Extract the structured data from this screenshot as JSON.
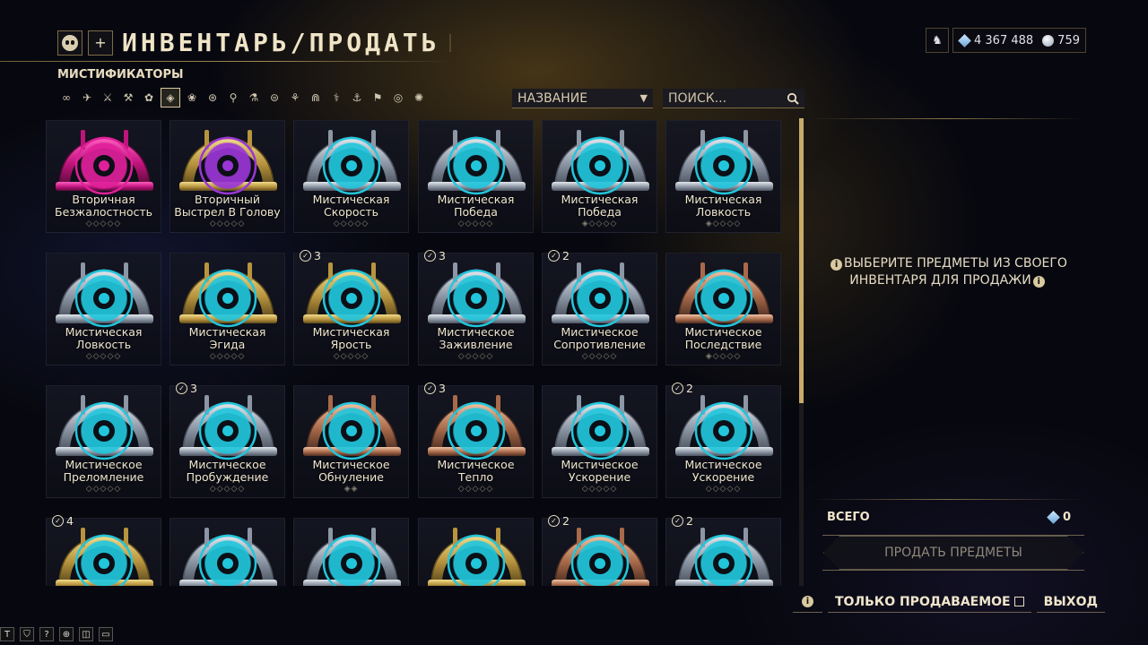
{
  "header": {
    "title": "ИНВЕНТАРЬ/ПРОДАТЬ",
    "add_label": "+"
  },
  "currency": {
    "platinum": "4 367 488",
    "credits_orbs": "759"
  },
  "category": "МИСТИФИКАТОРЫ",
  "filters": [
    "∞",
    "✈",
    "⚔",
    "⚒",
    "✿",
    "◈",
    "❀",
    "⊛",
    "⚲",
    "⚗",
    "⊜",
    "⚘",
    "⋒",
    "⚕",
    "⚓",
    "⚑",
    "◎",
    "✺"
  ],
  "filter_selected_index": 5,
  "sort": {
    "label": "НАЗВАНИЕ",
    "arrow": "▼"
  },
  "search": {
    "placeholder": "ПОИСК..."
  },
  "colors": {
    "accent_cyan": "#27c4d8",
    "gold": "#c8ab6a",
    "pink": "#e0208f",
    "purple": "#9b3ad8"
  },
  "items": [
    {
      "name": [
        "Вторичная",
        "Безжалостность"
      ],
      "stars": "◇◇◇◇◇",
      "owned": "",
      "frame": "magenta",
      "glyph": "pink"
    },
    {
      "name": [
        "Вторичный",
        "Выстрел В Голову"
      ],
      "stars": "◇◇◇◇◇",
      "owned": "",
      "frame": "gold",
      "glyph": "purple"
    },
    {
      "name": [
        "Мистическая",
        "Скорость"
      ],
      "stars": "◇◇◇◇◇",
      "owned": "",
      "frame": "silver",
      "glyph": "cyan"
    },
    {
      "name": [
        "Мистическая",
        "Победа"
      ],
      "stars": "◇◇◇◇◇",
      "owned": "",
      "frame": "silver",
      "glyph": "cyan"
    },
    {
      "name": [
        "Мистическая",
        "Победа"
      ],
      "stars": "◈◇◇◇◇",
      "owned": "",
      "frame": "silver",
      "glyph": "cyan"
    },
    {
      "name": [
        "Мистическая",
        "Ловкость"
      ],
      "stars": "◈◇◇◇◇",
      "owned": "",
      "frame": "silver",
      "glyph": "cyan"
    },
    {
      "name": [
        "Мистическая",
        "Ловкость"
      ],
      "stars": "◇◇◇◇◇",
      "owned": "",
      "frame": "silver",
      "glyph": "cyan"
    },
    {
      "name": [
        "Мистическая",
        "Эгида"
      ],
      "stars": "◇◇◇◇◇",
      "owned": "",
      "frame": "gold",
      "glyph": "cyan"
    },
    {
      "name": [
        "Мистическая",
        "Ярость"
      ],
      "stars": "◇◇◇◇◇",
      "owned": "3",
      "frame": "gold",
      "glyph": "cyan"
    },
    {
      "name": [
        "Мистическое",
        "Заживление"
      ],
      "stars": "◇◇◇◇◇",
      "owned": "3",
      "frame": "silver",
      "glyph": "cyan"
    },
    {
      "name": [
        "Мистическое",
        "Сопротивление"
      ],
      "stars": "◇◇◇◇◇",
      "owned": "2",
      "frame": "silver",
      "glyph": "cyan"
    },
    {
      "name": [
        "Мистическое",
        "Последствие"
      ],
      "stars": "◈◇◇◇◇",
      "owned": "",
      "frame": "bronze",
      "glyph": "cyan"
    },
    {
      "name": [
        "Мистическое",
        "Преломление"
      ],
      "stars": "◇◇◇◇◇",
      "owned": "",
      "frame": "silver",
      "glyph": "cyan"
    },
    {
      "name": [
        "Мистическое",
        "Пробуждение"
      ],
      "stars": "◇◇◇◇◇",
      "owned": "3",
      "frame": "silver",
      "glyph": "cyan"
    },
    {
      "name": [
        "Мистическое",
        "Обнуление"
      ],
      "stars": "◈◈",
      "owned": "",
      "frame": "bronze",
      "glyph": "cyan"
    },
    {
      "name": [
        "Мистическое",
        "Тепло"
      ],
      "stars": "◇◇◇◇◇",
      "owned": "3",
      "frame": "bronze",
      "glyph": "cyan"
    },
    {
      "name": [
        "Мистическое",
        "Ускорение"
      ],
      "stars": "◇◇◇◇◇",
      "owned": "",
      "frame": "silver",
      "glyph": "cyan"
    },
    {
      "name": [
        "Мистическое",
        "Ускорение"
      ],
      "stars": "◇◇◇◇◇",
      "owned": "2",
      "frame": "silver",
      "glyph": "cyan"
    },
    {
      "name": [
        "",
        ""
      ],
      "stars": "",
      "owned": "4",
      "frame": "gold",
      "glyph": "cyan"
    },
    {
      "name": [
        "",
        ""
      ],
      "stars": "",
      "owned": "",
      "frame": "silver",
      "glyph": "cyan"
    },
    {
      "name": [
        "",
        ""
      ],
      "stars": "",
      "owned": "",
      "frame": "silver",
      "glyph": "cyan"
    },
    {
      "name": [
        "",
        ""
      ],
      "stars": "",
      "owned": "",
      "frame": "gold",
      "glyph": "cyan"
    },
    {
      "name": [
        "",
        ""
      ],
      "stars": "",
      "owned": "2",
      "frame": "bronze",
      "glyph": "cyan"
    },
    {
      "name": [
        "",
        ""
      ],
      "stars": "",
      "owned": "2",
      "frame": "silver",
      "glyph": "cyan"
    }
  ],
  "right_panel": {
    "hint_line1": "ВЫБЕРИТЕ ПРЕДМЕТЫ ИЗ СВОЕГО",
    "hint_line2": "ИНВЕНТАРЯ ДЛЯ ПРОДАЖИ",
    "total_label": "ВСЕГО",
    "total_value": "0",
    "sell_label": "ПРОДАТЬ ПРЕДМЕТЫ"
  },
  "footer": {
    "only_sellable": "ТОЛЬКО ПРОДАВАЕМОЕ",
    "exit": "ВЫХОД"
  },
  "system_tray": [
    "T",
    "⛉",
    "?",
    "⊕",
    "◫",
    "▭"
  ]
}
